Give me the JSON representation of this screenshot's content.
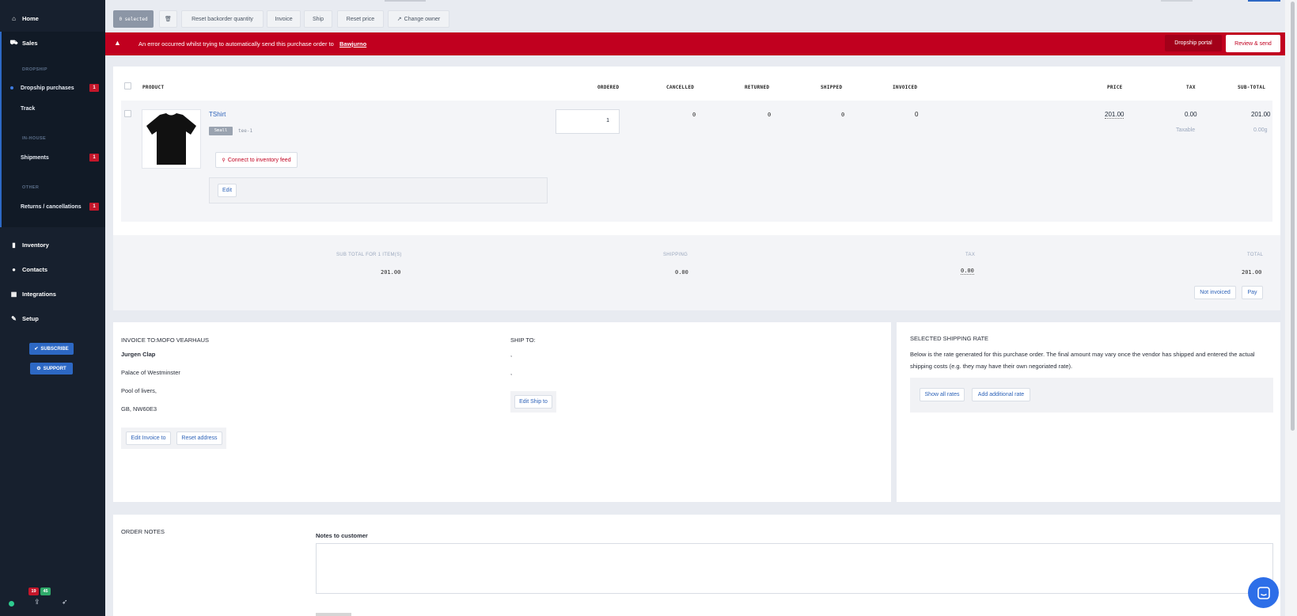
{
  "sidebar": {
    "home": "Home",
    "sales": "Sales",
    "dropship_section": "DROPSHIP",
    "dropship_purchases": "Dropship purchases",
    "dropship_purchases_badge": "1",
    "track": "Track",
    "inhouse_section": "IN-HOUSE",
    "shipments": "Shipments",
    "shipments_badge": "1",
    "other_section": "OTHER",
    "returns": "Returns / cancellations",
    "returns_badge": "1",
    "inventory": "Inventory",
    "contacts": "Contacts",
    "integrations": "Integrations",
    "setup": "Setup",
    "subscribe": "SUBSCRIBE",
    "support": "SUPPORT",
    "footer_badge_red": "19",
    "footer_badge_green": "45"
  },
  "toolbar": {
    "selected": "0 selected",
    "reset_backorder": "Reset backorder quantity",
    "invoice": "Invoice",
    "ship": "Ship",
    "reset_price": "Reset price",
    "change_owner": "Change owner"
  },
  "error": {
    "message": "An error occurred whilst trying to automatically send this purchase order to",
    "vendor": "Bawjurno",
    "dropship_portal": "Dropship portal",
    "review_send": "Review & send"
  },
  "table": {
    "headers": {
      "product": "PRODUCT",
      "ordered": "ORDERED",
      "cancelled": "CANCELLED",
      "returned": "RETURNED",
      "shipped": "SHIPPED",
      "invoiced": "INVOICED",
      "price": "PRICE",
      "tax": "TAX",
      "subtotal": "SUB-TOTAL"
    },
    "row": {
      "name": "TShirt",
      "variant": "Small",
      "sku": "tee-1",
      "connect": "Connect to inventory feed",
      "edit": "Edit",
      "ordered": "1",
      "cancelled": "0",
      "returned": "0",
      "shipped": "0",
      "invoiced": "0",
      "price": "201.00",
      "tax": "0.00",
      "tax_label": "Taxable",
      "subtotal": "201.00",
      "weight": "0.00g"
    }
  },
  "totals": {
    "subtotal_label": "SUB TOTAL FOR 1 ITEM(S)",
    "subtotal": "201.00",
    "shipping_label": "SHIPPING",
    "shipping": "0.00",
    "tax_label": "TAX",
    "tax": "0.00",
    "total_label": "TOTAL",
    "total": "201.00",
    "not_invoiced": "Not invoiced",
    "pay": "Pay"
  },
  "invoice_to": {
    "title": "INVOICE TO:MOFO VEARHAUS",
    "name": "Jurgen Clap",
    "line1": "Palace of Westminster",
    "line2": "Pool of livers,",
    "line3": "GB, NW60E3",
    "edit": "Edit Invoice to",
    "reset": "Reset address"
  },
  "ship_to": {
    "title": "SHIP TO:",
    "line1": ",",
    "line2": ",",
    "edit": "Edit Ship to"
  },
  "shipping_rate": {
    "title": "SELECTED SHIPPING RATE",
    "description": "Below is the rate generated for this purchase order. The final amount may vary once the vendor has shipped and entered the actual shipping costs (e.g. they may have their own negoriated rate).",
    "show_all": "Show all rates",
    "add_rate": "Add additional rate"
  },
  "notes": {
    "title": "ORDER NOTES",
    "customer_label": "Notes to customer"
  }
}
